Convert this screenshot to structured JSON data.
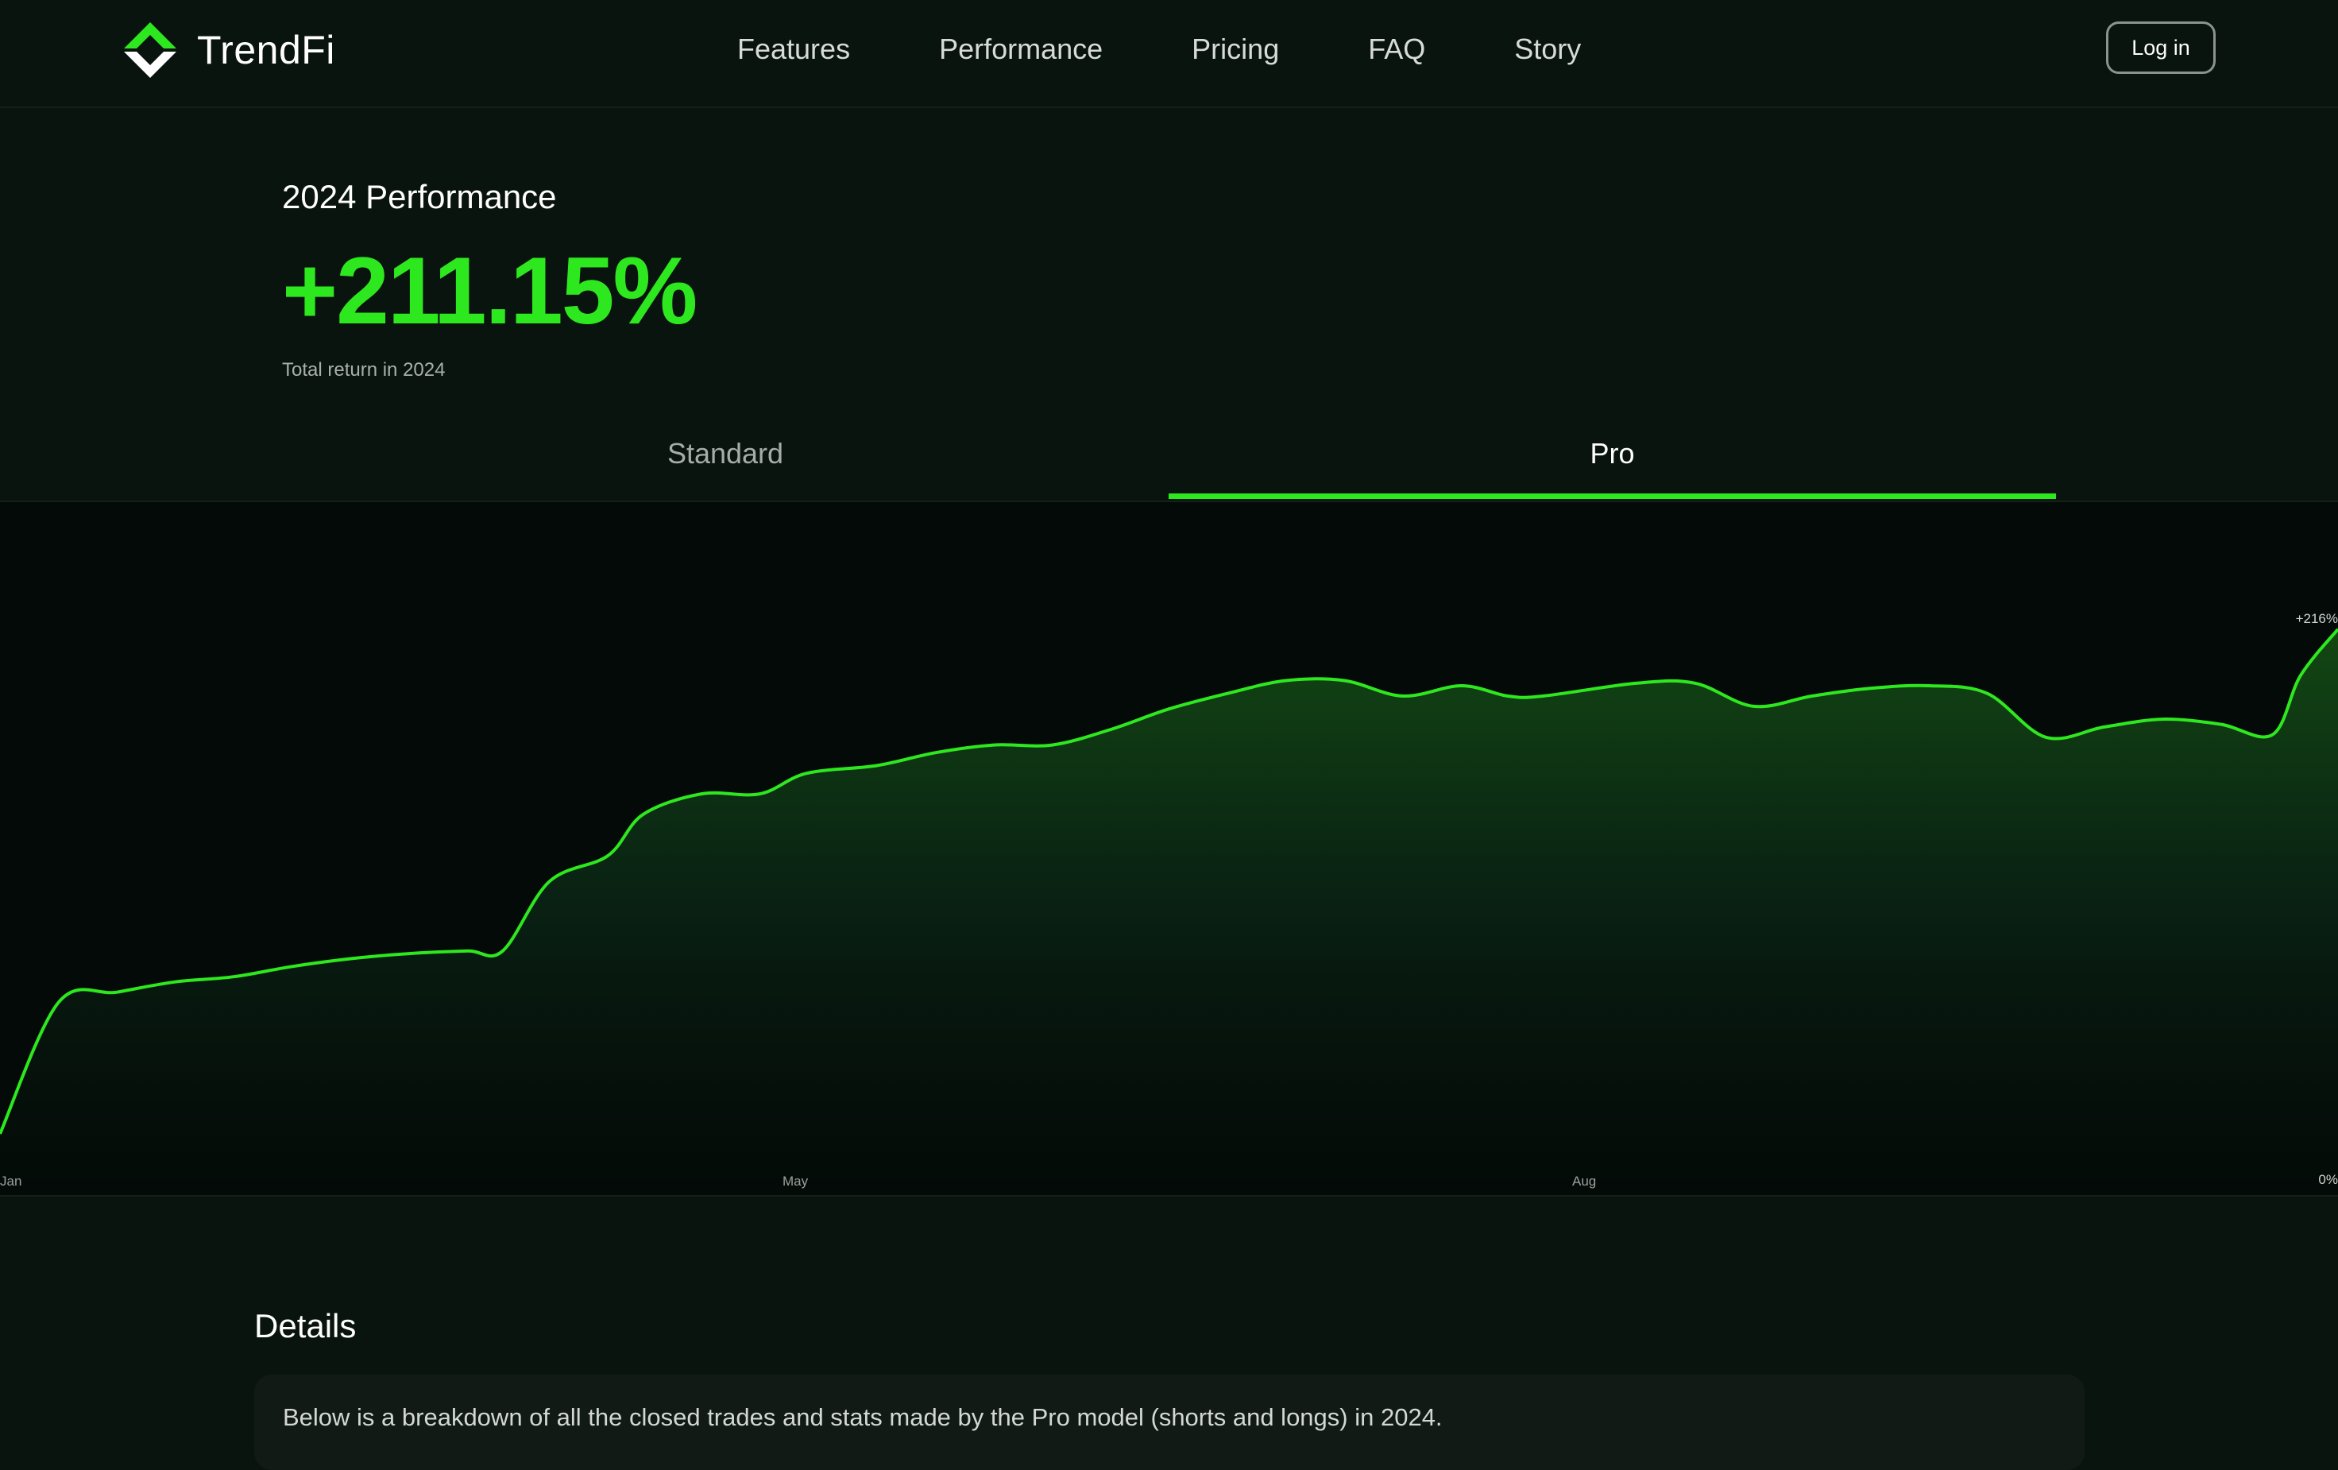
{
  "nav": {
    "brand": "TrendFi",
    "links": [
      "Features",
      "Performance",
      "Pricing",
      "FAQ",
      "Story"
    ],
    "login_label": "Log in"
  },
  "performance": {
    "heading": "2024 Performance",
    "value": "+211.15%",
    "subtitle": "Total return in 2024"
  },
  "tabs": {
    "standard": "Standard",
    "pro": "Pro",
    "active": "Pro"
  },
  "colors": {
    "accent": "#2ee81f",
    "background": "#0a140e"
  },
  "chart_data": {
    "type": "area",
    "x_tick_labels": [
      "Jan",
      "May",
      "Aug"
    ],
    "y_end_label": "+216%",
    "y_zero_label": "0%",
    "ylim": [
      0,
      216
    ],
    "x": [
      0,
      0.025,
      0.05,
      0.075,
      0.1,
      0.125,
      0.15,
      0.175,
      0.2,
      0.215,
      0.235,
      0.26,
      0.275,
      0.3,
      0.325,
      0.345,
      0.375,
      0.4,
      0.425,
      0.45,
      0.475,
      0.5,
      0.525,
      0.55,
      0.575,
      0.6,
      0.625,
      0.645,
      0.66,
      0.7,
      0.725,
      0.75,
      0.775,
      0.8,
      0.825,
      0.85,
      0.875,
      0.9,
      0.925,
      0.95,
      0.972,
      0.984,
      1.0
    ],
    "y": [
      17,
      68,
      72,
      76,
      78,
      82,
      85,
      87,
      88,
      88,
      115,
      125,
      141,
      149,
      149,
      157,
      160,
      165,
      168,
      168,
      174,
      182,
      188,
      193,
      193,
      187,
      191,
      187,
      187,
      192,
      192,
      183,
      187,
      190,
      191,
      188,
      171,
      175,
      178,
      176,
      172,
      195,
      213
    ]
  },
  "details": {
    "title": "Details",
    "text": "Below is a breakdown of all the closed trades and stats made by the Pro model (shorts and longs) in 2024."
  }
}
